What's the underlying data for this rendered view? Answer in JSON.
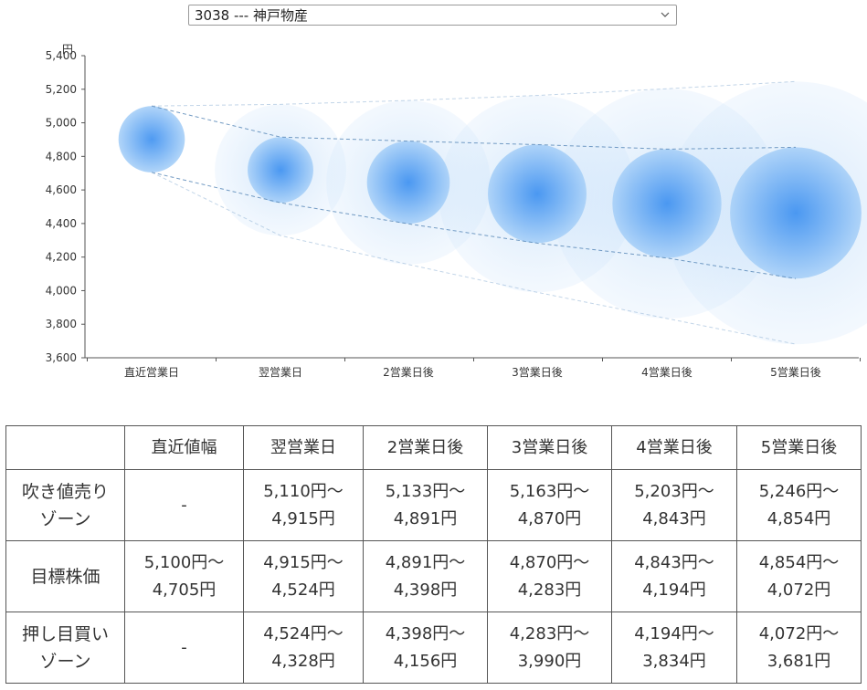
{
  "selector": {
    "value": "3038 --- 神戸物産"
  },
  "chart_data": {
    "type": "bubble",
    "ylabel": "円",
    "ylim": [
      3600,
      5400
    ],
    "yticks": [
      "3,600",
      "3,800",
      "4,000",
      "4,200",
      "4,400",
      "4,600",
      "4,800",
      "5,000",
      "5,200",
      "5,400"
    ],
    "categories": [
      "直近営業日",
      "翌営業日",
      "2営業日後",
      "3営業日後",
      "4営業日後",
      "5営業日後"
    ],
    "center": [
      4902,
      4719,
      4645,
      4577,
      4519,
      4463
    ],
    "target_high": [
      5100,
      4915,
      4891,
      4870,
      4843,
      4854
    ],
    "target_low": [
      4705,
      4524,
      4398,
      4283,
      4194,
      4072
    ],
    "outer_high": [
      5100,
      5110,
      5133,
      5163,
      5203,
      5246
    ],
    "outer_low": [
      4705,
      4328,
      4156,
      3990,
      3834,
      3681
    ],
    "colors": {
      "core": "#3b8ff0",
      "halo": "#cfe5fb",
      "band": "#5a8ab8"
    }
  },
  "table": {
    "headers": [
      "",
      "直近値幅",
      "翌営業日",
      "2営業日後",
      "3営業日後",
      "4営業日後",
      "5営業日後"
    ],
    "rows": [
      {
        "label": [
          "吹き値売り",
          "ゾーン"
        ],
        "cells": [
          [
            "-"
          ],
          [
            "5,110円～",
            "4,915円"
          ],
          [
            "5,133円～",
            "4,891円"
          ],
          [
            "5,163円～",
            "4,870円"
          ],
          [
            "5,203円～",
            "4,843円"
          ],
          [
            "5,246円～",
            "4,854円"
          ]
        ]
      },
      {
        "label": [
          "目標株価"
        ],
        "cells": [
          [
            "5,100円～",
            "4,705円"
          ],
          [
            "4,915円～",
            "4,524円"
          ],
          [
            "4,891円～",
            "4,398円"
          ],
          [
            "4,870円～",
            "4,283円"
          ],
          [
            "4,843円～",
            "4,194円"
          ],
          [
            "4,854円～",
            "4,072円"
          ]
        ]
      },
      {
        "label": [
          "押し目買い",
          "ゾーン"
        ],
        "cells": [
          [
            "-"
          ],
          [
            "4,524円～",
            "4,328円"
          ],
          [
            "4,398円～",
            "4,156円"
          ],
          [
            "4,283円～",
            "3,990円"
          ],
          [
            "4,194円～",
            "3,834円"
          ],
          [
            "4,072円～",
            "3,681円"
          ]
        ]
      }
    ]
  }
}
